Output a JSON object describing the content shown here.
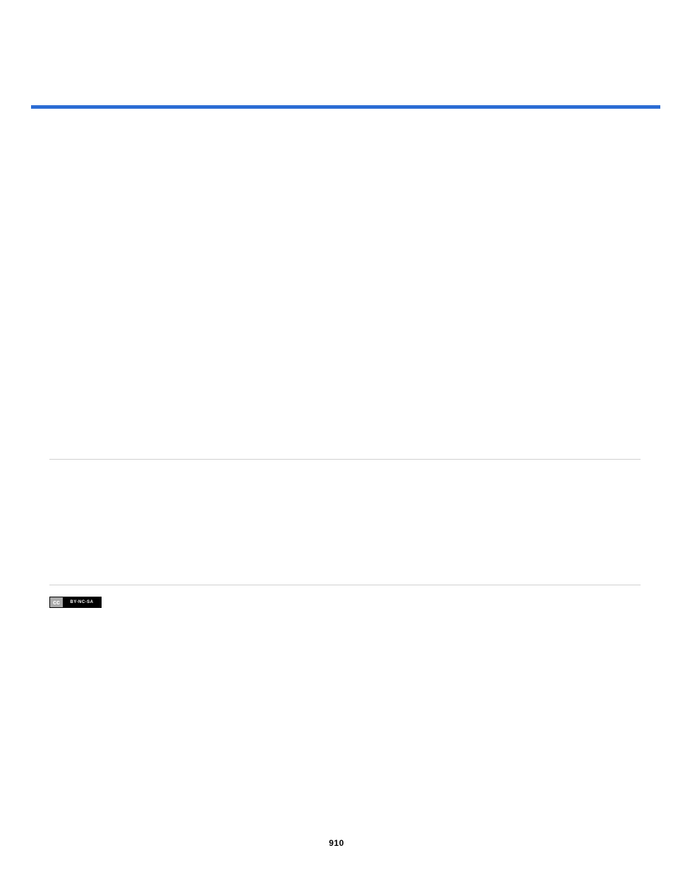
{
  "page": {
    "number": "910"
  },
  "license": {
    "cc_label": "cc",
    "terms_label": "BY-NC-SA"
  }
}
